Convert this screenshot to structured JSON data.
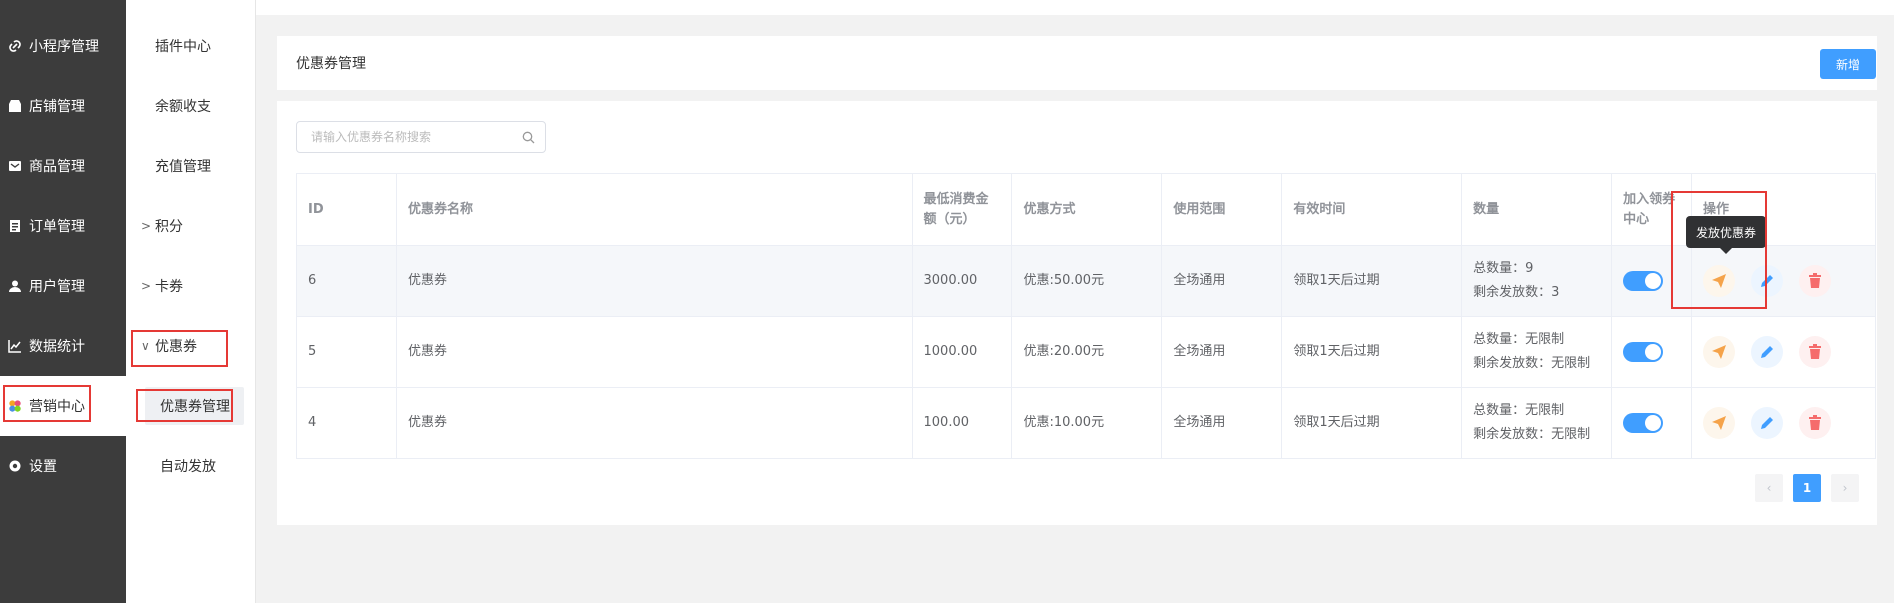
{
  "sidebar": {
    "items": [
      {
        "label": "小程序管理",
        "icon": "link-icon"
      },
      {
        "label": "店铺管理",
        "icon": "shop-icon"
      },
      {
        "label": "商品管理",
        "icon": "goods-icon"
      },
      {
        "label": "订单管理",
        "icon": "order-icon"
      },
      {
        "label": "用户管理",
        "icon": "user-icon"
      },
      {
        "label": "数据统计",
        "icon": "chart-icon"
      },
      {
        "label": "营销中心",
        "icon": "marketing-icon"
      },
      {
        "label": "设置",
        "icon": "gear-icon"
      }
    ]
  },
  "submenu": {
    "plugin_center": "插件中心",
    "balance": "余额收支",
    "recharge": "充值管理",
    "points": "积分",
    "card": "卡券",
    "coupon": "优惠券",
    "coupon_manage": "优惠券管理",
    "auto_issue": "自动发放"
  },
  "header": {
    "title": "优惠券管理",
    "add_label": "新增"
  },
  "search": {
    "placeholder": "请输入优惠券名称搜索"
  },
  "table": {
    "columns": [
      "ID",
      "优惠券名称",
      "最低消费金额（元）",
      "优惠方式",
      "使用范围",
      "有效时间",
      "数量",
      "加入领券中心",
      "操作"
    ],
    "rows": [
      {
        "id": "6",
        "name": "优惠券",
        "min": "3000.00",
        "discount": "优惠:50.00元",
        "scope": "全场通用",
        "valid": "领取1天后过期",
        "total": "总数量：9",
        "remain": "剩余发放数：3"
      },
      {
        "id": "5",
        "name": "优惠券",
        "min": "1000.00",
        "discount": "优惠:20.00元",
        "scope": "全场通用",
        "valid": "领取1天后过期",
        "total": "总数量：无限制",
        "remain": "剩余发放数：无限制"
      },
      {
        "id": "4",
        "name": "优惠券",
        "min": "100.00",
        "discount": "优惠:10.00元",
        "scope": "全场通用",
        "valid": "领取1天后过期",
        "total": "总数量：无限制",
        "remain": "剩余发放数：无限制"
      }
    ]
  },
  "tooltip": "发放优惠券",
  "pagination": {
    "prev": "‹",
    "current": "1",
    "next": "›"
  },
  "colors": {
    "primary": "#409eff",
    "sidebar_bg": "#3c3c3c",
    "highlight": "#e53935",
    "send": "#f5a34a",
    "delete": "#f56c6c"
  }
}
